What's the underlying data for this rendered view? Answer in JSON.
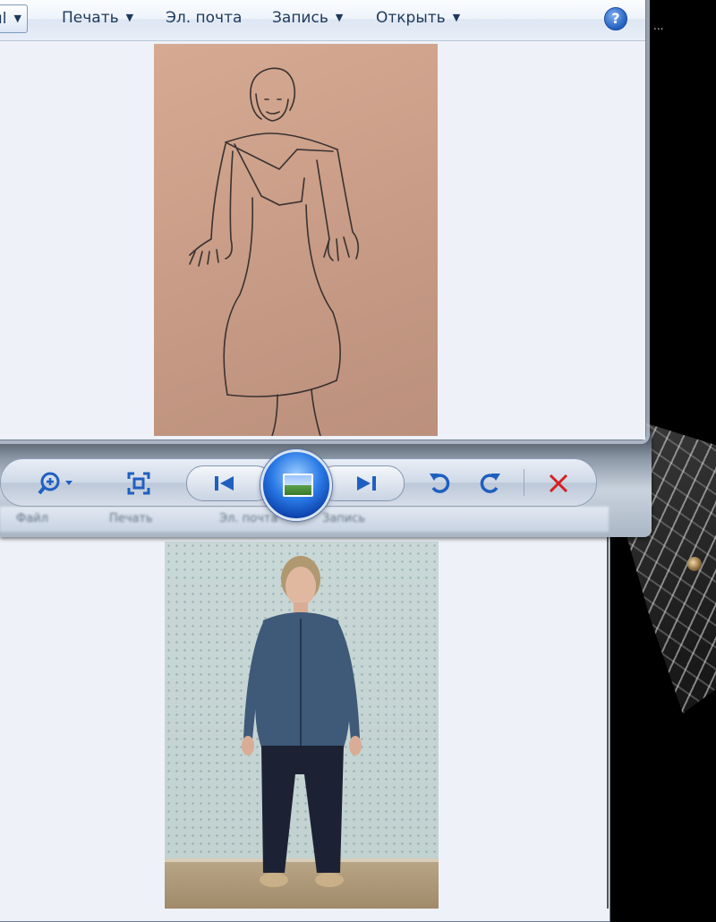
{
  "top_window": {
    "toolbar": {
      "file_label": "ıl",
      "print_label": "Печать",
      "email_label": "Эл. почта",
      "burn_label": "Запись",
      "open_label": "Открыть",
      "help_label": "?"
    }
  },
  "bottom_window": {
    "ghost_toolbar": {
      "file_label": "Файл",
      "print_label": "Печать",
      "email_label": "Эл. почта",
      "burn_label": "Запись"
    }
  },
  "desktop": {
    "edge_text": "..."
  },
  "icons": {
    "dropdown": "▼",
    "zoom": "search-zoom-icon",
    "fit": "actual-size-icon",
    "prev": "previous-icon",
    "next": "next-icon",
    "rotate_ccw": "rotate-left-icon",
    "rotate_cw": "rotate-right-icon",
    "delete": "delete-icon",
    "slideshow": "slideshow-icon"
  },
  "colors": {
    "accent_blue": "#1f5fc0",
    "delete_red": "#d42020",
    "toolbar_text": "#1e395b"
  }
}
